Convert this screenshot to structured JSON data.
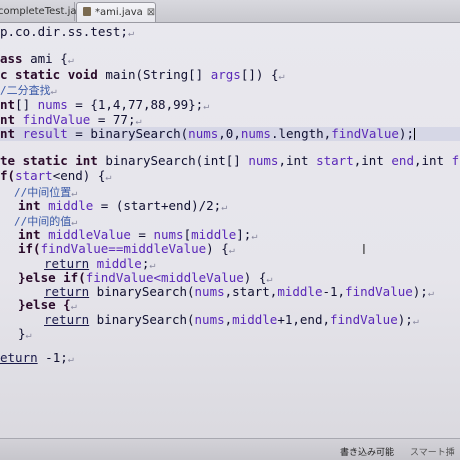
{
  "tabs": [
    {
      "label": "completeTest.java"
    },
    {
      "label": "*ami.java",
      "close": "⊠"
    }
  ],
  "code": {
    "l01": {
      "pkg": "p.co.dir.ss.test;"
    },
    "l02": {
      "kw": "ass",
      "name": " ami {"
    },
    "l03": {
      "kw": "c static void",
      "name": " main(String[] ",
      "var": "args",
      "rest": "[]) {"
    },
    "l04": {
      "com": "/二分査找"
    },
    "l05": {
      "kw": "nt",
      "rest1": "[] ",
      "var": "nums",
      "rest2": " = {1,4,77,88,99};"
    },
    "l06": {
      "kw": "nt",
      "rest1": " ",
      "var": "findValue",
      "rest2": " = 77;"
    },
    "l07": {
      "kw": "nt",
      "rest1": " ",
      "var": "result",
      "rest2": " = binarySearch(",
      "a1": "nums",
      "r3": ",0,",
      "a2": "nums",
      "r4": ".length,",
      "a3": "findValue",
      "r5": ");"
    },
    "l08": {
      "kw": "te static int",
      "rest1": " binarySearch(int[] ",
      "v1": "nums",
      "r2": ",int ",
      "v2": "start",
      "r3": ",int ",
      "v3": "end",
      "r4": ",int ",
      "v4": "findValue"
    },
    "l09": {
      "kw": "f(",
      "var": "start",
      "rest": "<end) {"
    },
    "l10": {
      "com": "//中间位置"
    },
    "l11": {
      "kw": "int",
      "rest1": " ",
      "var": "middle",
      "rest2": " = (start+end)/2;"
    },
    "l12": {
      "com": "//中间的值"
    },
    "l13": {
      "kw": "int",
      "rest1": " ",
      "var": "middleValue",
      "rest2": " = ",
      "v2": "nums",
      "r3": "[",
      "v3": "middle",
      "r4": "];"
    },
    "l14": {
      "kw": "if(",
      "var": "findValue==middleValue",
      "rest": ") {"
    },
    "l15": {
      "kw": "return",
      "var": " middle",
      "rest": ";"
    },
    "l16": {
      "kw": "}else if(",
      "var": "findValue<middleValue",
      "rest": ") {"
    },
    "l17": {
      "kw": "return",
      "rest1": " binarySearch(",
      "v1": "nums",
      "r2": ",start,",
      "v2": "middle",
      "r3": "-1,",
      "v3": "findValue",
      "r4": ");"
    },
    "l18": {
      "kw": "}else {"
    },
    "l19": {
      "kw": "return",
      "rest1": " binarySearch(",
      "v1": "nums",
      "r2": ",",
      "v2": "middle",
      "r3": "+1,end,",
      "v3": "findValue",
      "r4": ");"
    },
    "l20": {
      "rest": "}"
    },
    "l21": {
      "kw": "eturn",
      "rest": " -1;"
    }
  },
  "eol_mark": "↵",
  "status": {
    "mode": "書き込み可能",
    "insert": "スマート挿入"
  }
}
